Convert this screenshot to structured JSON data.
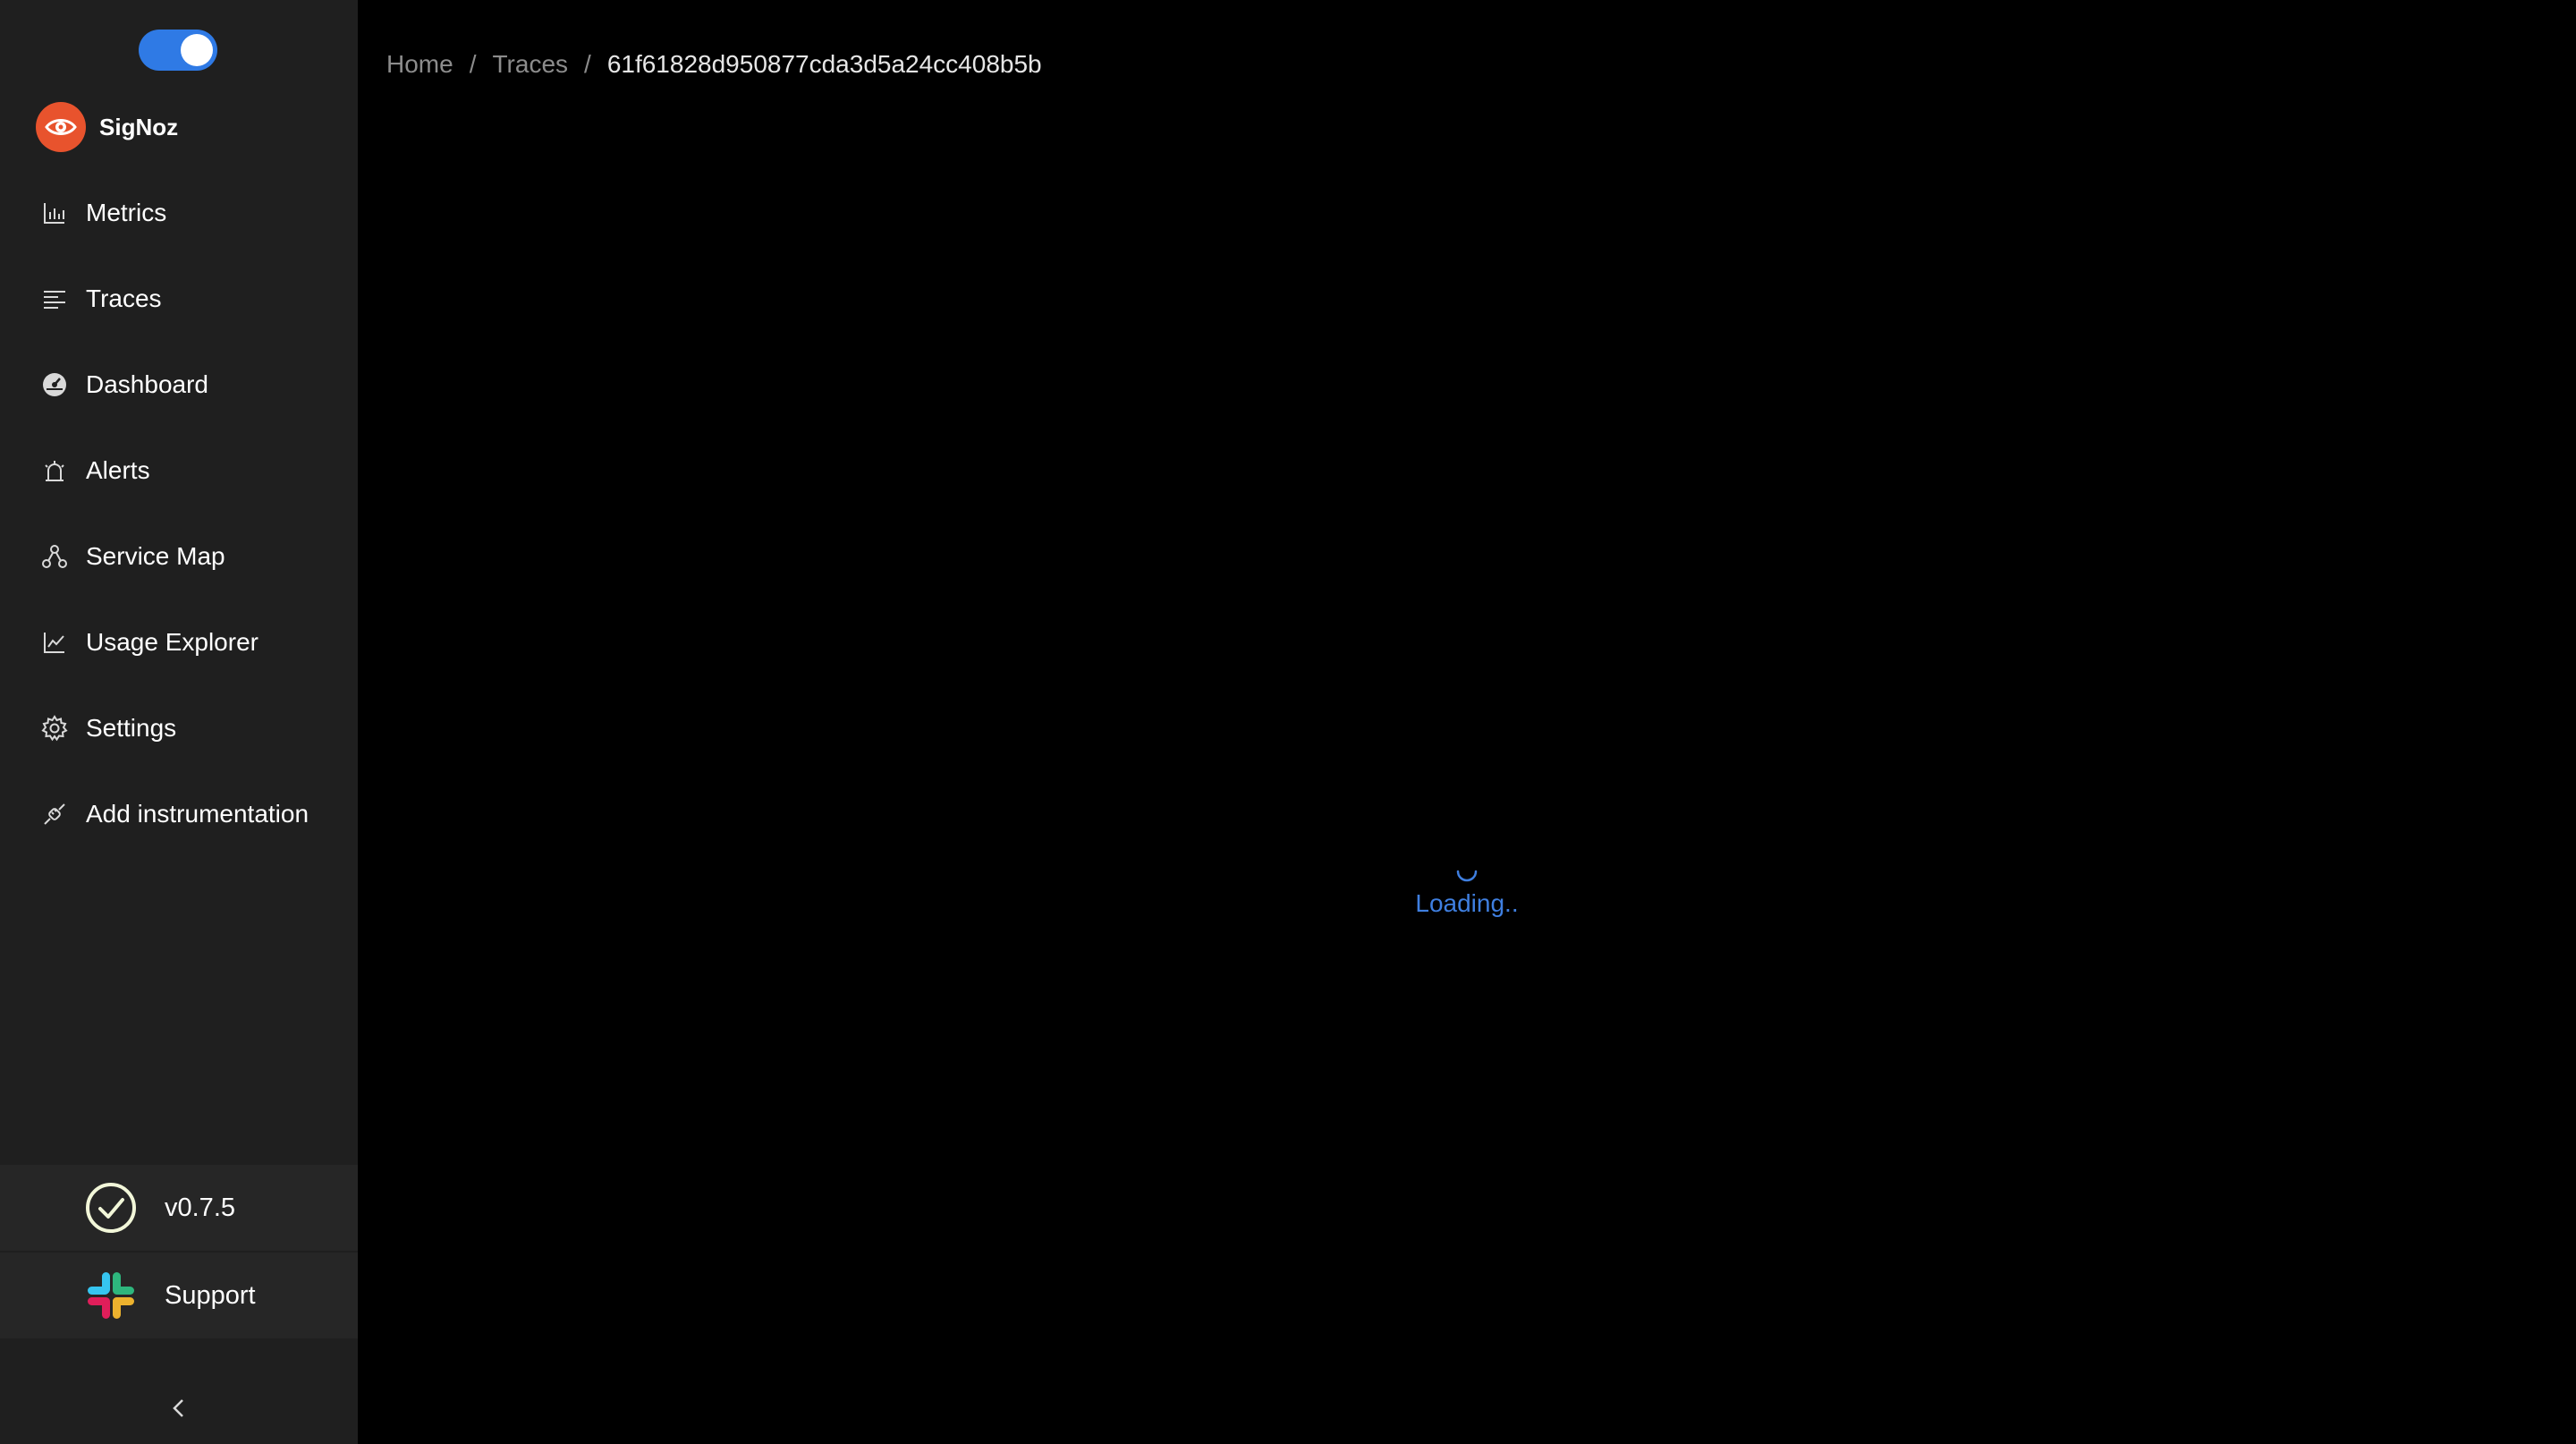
{
  "app": {
    "brand_name": "SigNoz",
    "theme_toggle": {
      "state": "on",
      "accent": "#2f7ae5"
    }
  },
  "sidebar": {
    "items": [
      {
        "label": "Metrics",
        "icon": "bar-chart-icon"
      },
      {
        "label": "Traces",
        "icon": "align-left-icon"
      },
      {
        "label": "Dashboard",
        "icon": "dashboard-icon"
      },
      {
        "label": "Alerts",
        "icon": "alarm-icon"
      },
      {
        "label": "Service Map",
        "icon": "deployment-unit-icon"
      },
      {
        "label": "Usage Explorer",
        "icon": "line-chart-icon"
      },
      {
        "label": "Settings",
        "icon": "gear-icon"
      },
      {
        "label": "Add instrumentation",
        "icon": "api-icon"
      }
    ],
    "version": {
      "label": "v0.7.5",
      "icon": "check-circle-icon"
    },
    "support": {
      "label": "Support",
      "icon": "slack-icon"
    },
    "collapse_icon": "chevron-left-icon"
  },
  "breadcrumb": {
    "items": [
      "Home",
      "Traces"
    ],
    "separator": "/",
    "current": "61f61828d950877cda3d5a24cc408b5b"
  },
  "main": {
    "loading_text": "Loading..",
    "loading_color": "#3f7fe0"
  }
}
